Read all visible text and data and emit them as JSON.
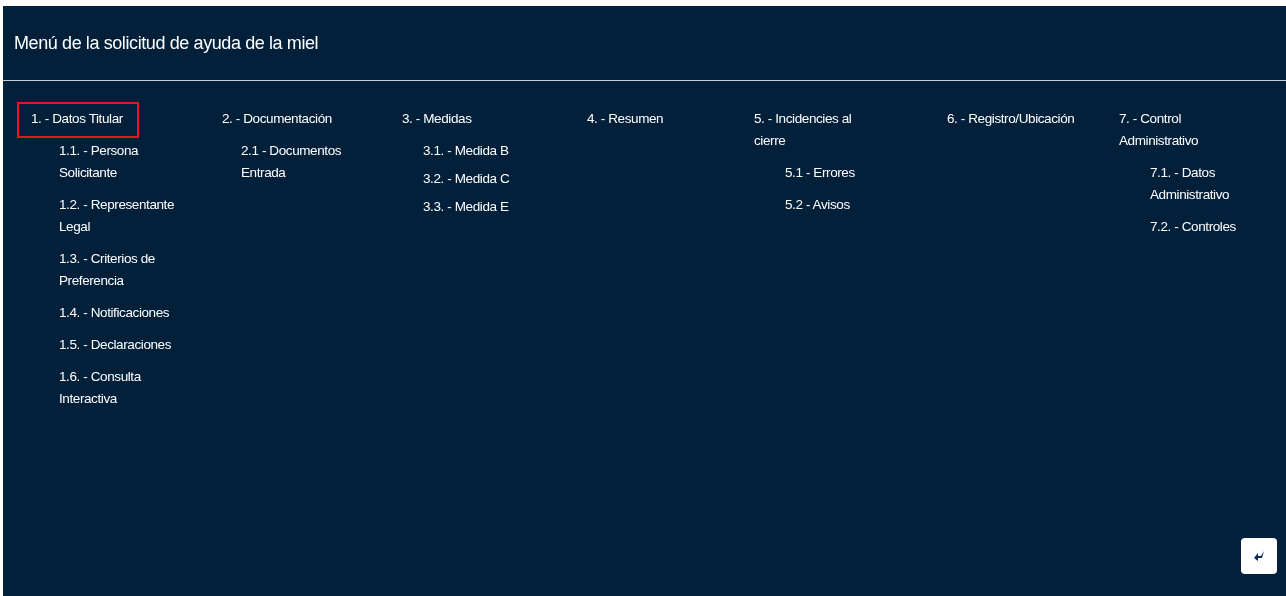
{
  "header": {
    "title": "Menú de la solicitud de ayuda de la miel"
  },
  "menu": [
    {
      "label": "1. - Datos Titular",
      "selected": true,
      "children": [
        {
          "label": "1.1. - Persona Solicitante"
        },
        {
          "label": "1.2. - Representante Legal"
        },
        {
          "label": "1.3. - Criterios de Preferencia"
        },
        {
          "label": "1.4. - Notificaciones"
        },
        {
          "label": "1.5. - Declaraciones"
        },
        {
          "label": "1.6. - Consulta Interactiva"
        }
      ]
    },
    {
      "label": "2. - Documentación",
      "selected": false,
      "children": [
        {
          "label": "2.1 - Documentos Entrada"
        }
      ]
    },
    {
      "label": "3. - Medidas",
      "selected": false,
      "children": [
        {
          "label": "3.1. - Medida B"
        },
        {
          "label": "3.2. - Medida C"
        },
        {
          "label": "3.3. - Medida E"
        }
      ]
    },
    {
      "label": "4. - Resumen",
      "selected": false
    },
    {
      "label": "5. - Incidencies al cierre",
      "selected": false,
      "children": [
        {
          "label": "5.1 - Errores"
        },
        {
          "label": "5.2 - Avisos"
        }
      ]
    },
    {
      "label": "6. - Registro/Ubicación",
      "selected": false
    },
    {
      "label": "7. - Control Administrativo",
      "selected": false,
      "children": [
        {
          "label": "7.1. - Datos Administrativo"
        },
        {
          "label": "7.2. - Controles"
        }
      ]
    }
  ]
}
